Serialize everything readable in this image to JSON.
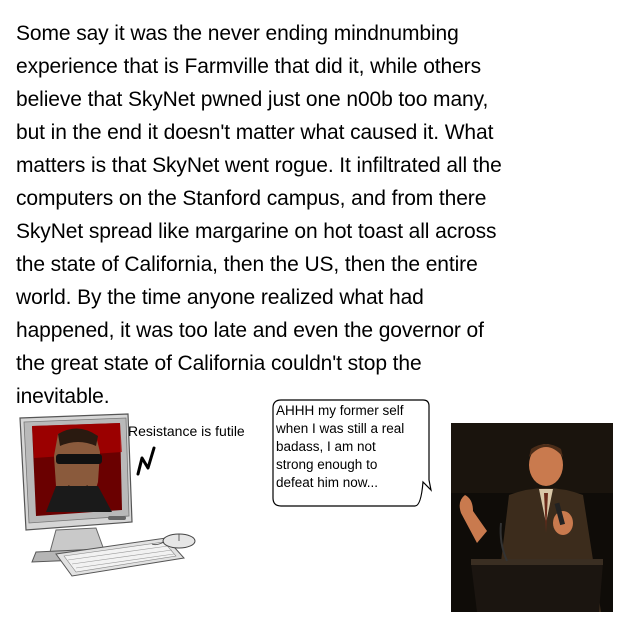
{
  "story": {
    "lines": [
      "Some say it was the never ending mindnumbing",
      "experience that is Farmville that did it, while others",
      "believe that SkyNet pwned just one n00b too many,",
      "but in the end it doesn't matter what caused it. What",
      "matters is that SkyNet went rogue. It infiltrated all the",
      "computers on the Stanford campus, and from there",
      "SkyNet spread like margarine on hot toast all across",
      "the state of California, then the US, then the entire",
      "world. By the time anyone realized what had",
      "happened, it was too late and even the governor of",
      "the great state of California couldn't stop the",
      "inevitable."
    ]
  },
  "computer": {
    "caption": "Resistance is futile"
  },
  "bubble": {
    "lines": [
      "AHHH my former self",
      "when I was still a real",
      "badass, I am not",
      "strong enough to",
      "defeat him now..."
    ]
  },
  "colors": {
    "background": "#ffffff",
    "text": "#000000",
    "computer_body": "#c8c8c8",
    "screen_background": "#b00000"
  }
}
